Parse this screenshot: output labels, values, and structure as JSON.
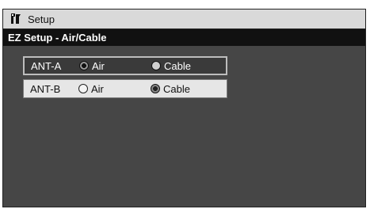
{
  "window": {
    "title": "Setup",
    "icon": "setup-menu-icon"
  },
  "subheader": {
    "title": "EZ Setup - Air/Cable"
  },
  "rows": [
    {
      "label": "ANT-A",
      "options": [
        "Air",
        "Cable"
      ],
      "selected": "Air"
    },
    {
      "label": "ANT-B",
      "options": [
        "Air",
        "Cable"
      ],
      "selected": "Cable"
    }
  ],
  "colors": {
    "titlebar": "#d9d9d9",
    "subheader": "#111111",
    "background": "#464646",
    "row_highlight": "#3a3a3a",
    "row_normal": "#e6e6e6"
  }
}
